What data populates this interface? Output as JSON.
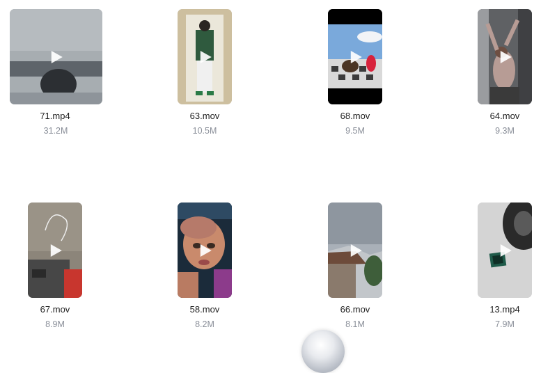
{
  "files": [
    {
      "name": "71.mp4",
      "size": "31.2M",
      "orientation": "landscape",
      "palette": [
        "#9aa0a4",
        "#6e7479",
        "#2c2f33"
      ]
    },
    {
      "name": "63.mov",
      "size": "10.5M",
      "orientation": "portrait",
      "palette": [
        "#c9bfa9",
        "#e9e4d6",
        "#2f5a3e"
      ]
    },
    {
      "name": "68.mov",
      "size": "9.5M",
      "orientation": "portrait",
      "palette": [
        "#79a6d6",
        "#e5e5e5",
        "#3b3b3b"
      ]
    },
    {
      "name": "64.mov",
      "size": "9.3M",
      "orientation": "portrait",
      "palette": [
        "#6f6f6f",
        "#b79c95",
        "#3a3a3a"
      ]
    },
    {
      "name": "67.mov",
      "size": "8.9M",
      "orientation": "portrait",
      "palette": [
        "#8c857a",
        "#4a4a4a",
        "#c8362e"
      ]
    },
    {
      "name": "58.mov",
      "size": "8.2M",
      "orientation": "portrait",
      "palette": [
        "#1b2b3a",
        "#c98a6c",
        "#8c3b8b"
      ]
    },
    {
      "name": "66.mov",
      "size": "8.1M",
      "orientation": "portrait",
      "palette": [
        "#a9b0b8",
        "#6d4b3a",
        "#3e5e3a"
      ]
    },
    {
      "name": "13.mp4",
      "size": "7.9M",
      "orientation": "portrait",
      "palette": [
        "#d4d4d4",
        "#2a2a2a",
        "#1f5b4a"
      ]
    }
  ],
  "icons": {
    "play": "play-icon"
  }
}
